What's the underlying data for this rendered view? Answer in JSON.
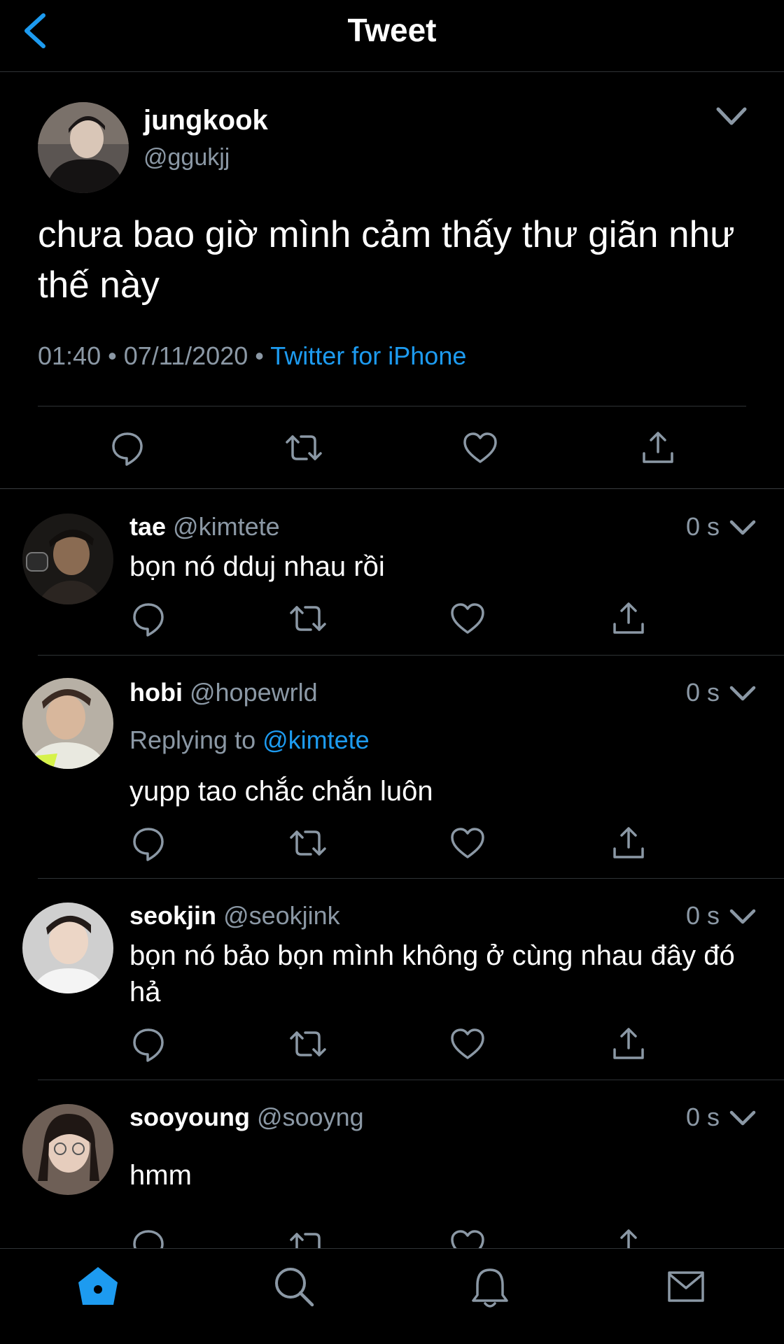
{
  "header": {
    "title": "Tweet"
  },
  "tweet": {
    "name": "jungkook",
    "handle": "@ggukjj",
    "text": "chưa bao giờ mình cảm thấy thư giãn như thế này",
    "time": "01:40",
    "date": "07/11/2020",
    "source": "Twitter for iPhone",
    "separator": "•"
  },
  "replies": [
    {
      "name": "tae",
      "handle": "@kimtete",
      "time": "0 s",
      "replying_prefix": "",
      "replying_to": "",
      "text": "bọn nó dduj nhau rồi"
    },
    {
      "name": "hobi",
      "handle": "@hopewrld",
      "time": "0 s",
      "replying_prefix": "Replying to",
      "replying_to": "@kimtete",
      "text": "yupp tao chắc chắn luôn"
    },
    {
      "name": "seokjin",
      "handle": "@seokjink",
      "time": "0 s",
      "replying_prefix": "",
      "replying_to": "",
      "text": "bọn nó bảo bọn mình không ở cùng nhau đây đó hả"
    },
    {
      "name": "sooyoung",
      "handle": "@sooyng",
      "time": "0 s",
      "replying_prefix": "",
      "replying_to": "",
      "text": "hmm"
    }
  ],
  "icons": {
    "back": "chevron-left-icon",
    "reply": "comment-icon",
    "retweet": "retweet-icon",
    "like": "heart-icon",
    "share": "share-icon",
    "more": "chevron-down-icon",
    "tabs": [
      "home-icon",
      "search-icon",
      "bell-icon",
      "mail-icon"
    ]
  },
  "colors": {
    "accent": "#1d9bf0",
    "background": "#000000",
    "secondary_text": "#8b98a5",
    "divider": "#2f3336"
  }
}
